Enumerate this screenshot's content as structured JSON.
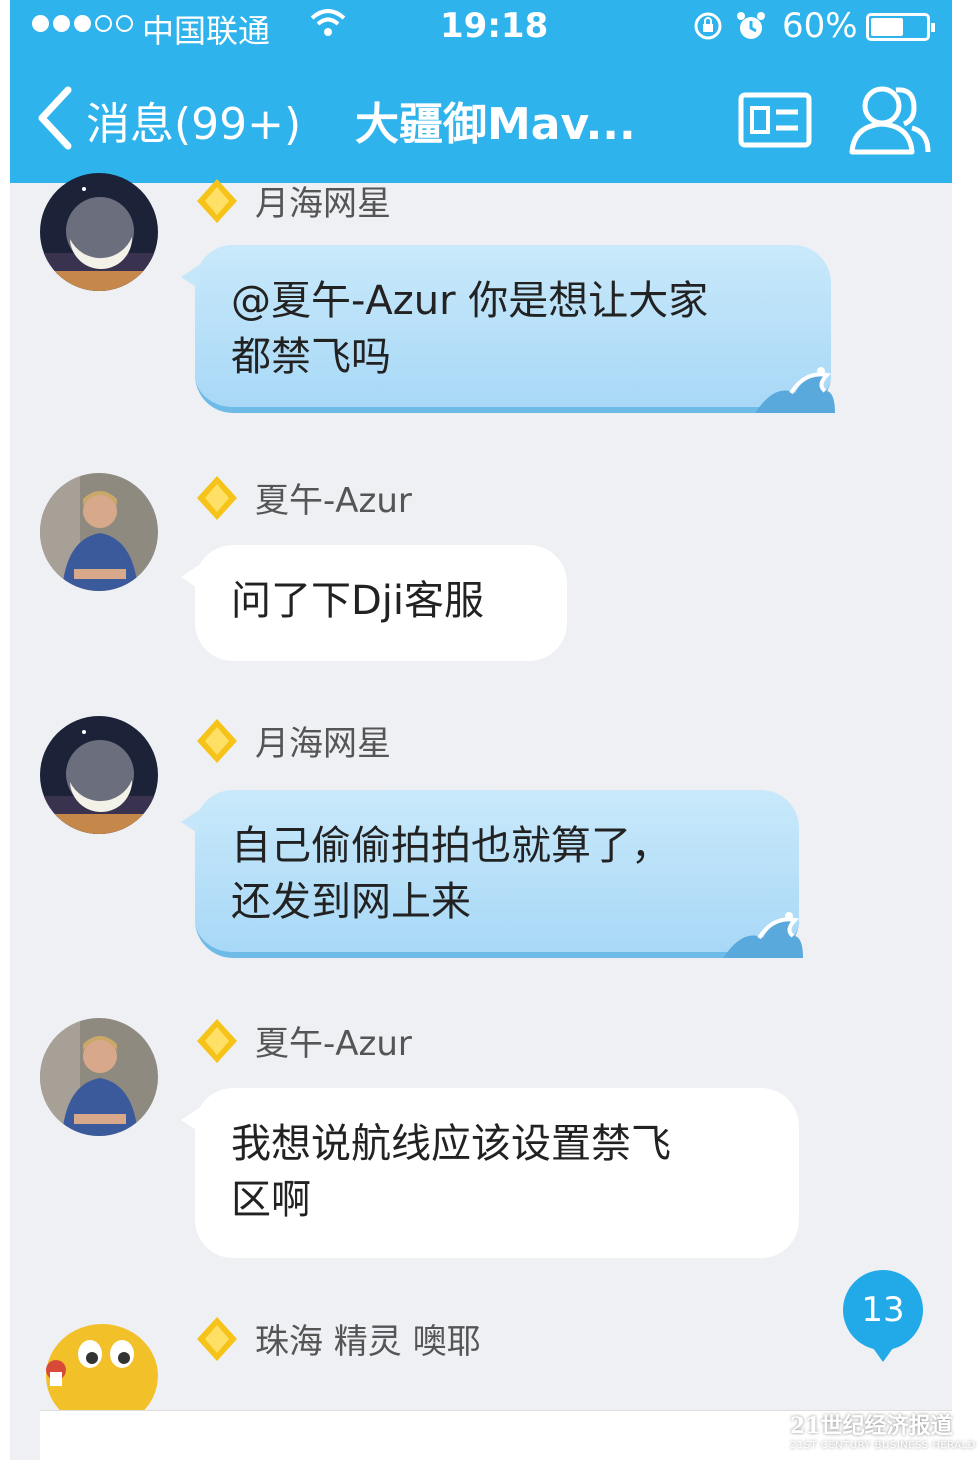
{
  "status_bar": {
    "carrier": "中国联通",
    "time": "19:18",
    "battery": "60%",
    "battery_level": 0.6
  },
  "nav": {
    "back_label": "消息(99+)",
    "title": "大疆御Mav...",
    "icons": [
      "back-chevron-icon",
      "profile-card-icon",
      "group-members-icon"
    ]
  },
  "messages": [
    {
      "sender": "月海网星",
      "text_lines": [
        "@夏午-Azur 你是想让大家",
        "都禁飞吗"
      ],
      "bubble": "blue"
    },
    {
      "sender": "夏午-Azur",
      "text_lines": [
        "问了下Dji客服"
      ],
      "bubble": "white"
    },
    {
      "sender": "月海网星",
      "text_lines": [
        "自己偷偷拍拍也就算了，",
        "还发到网上来"
      ],
      "bubble": "blue"
    },
    {
      "sender": "夏午-Azur",
      "text_lines": [
        "我想说航线应该设置禁飞",
        "区啊"
      ],
      "bubble": "white"
    },
    {
      "sender": "珠海 精灵 噢耶",
      "text_lines": [],
      "bubble": "none"
    }
  ],
  "unread_badge": "13",
  "watermark": {
    "main": "21世纪经济报道",
    "sub": "21ST CENTURY BUSINESS HERALD"
  },
  "colors": {
    "accent": "#2fb3ec",
    "blue_bubble": "#b8e0f8",
    "chat_bg": "#eef0f4",
    "badge": "#22a9e8"
  }
}
